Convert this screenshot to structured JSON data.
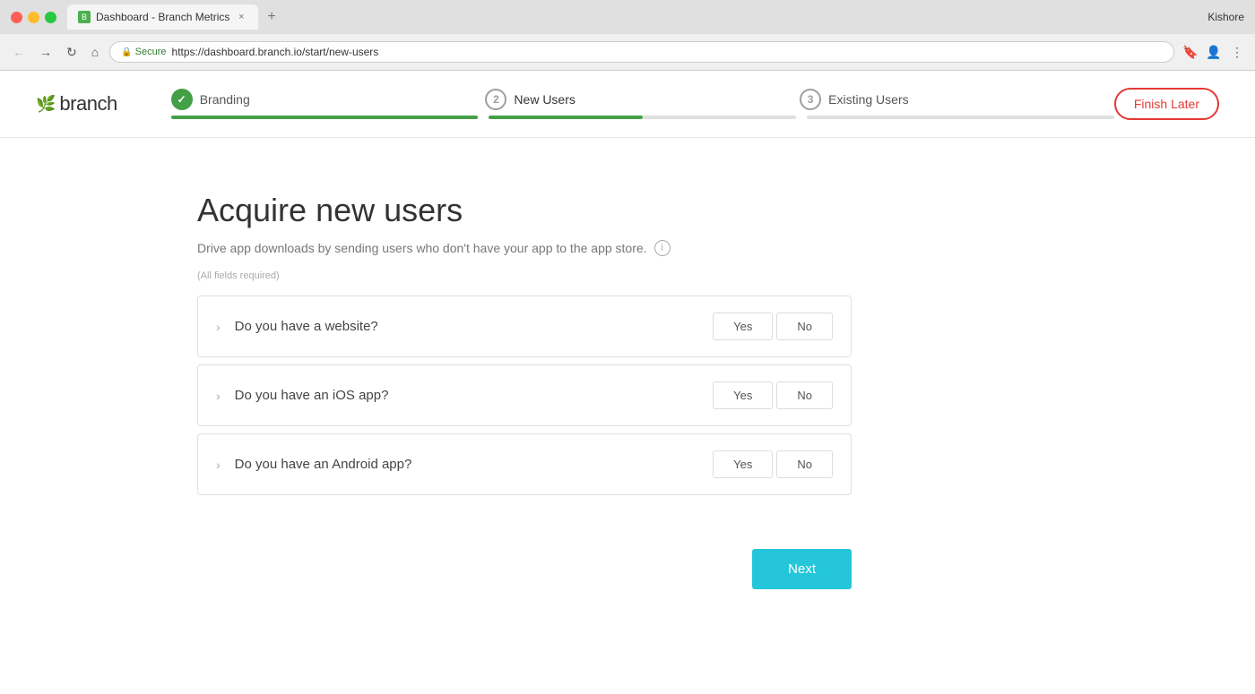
{
  "browser": {
    "tab_title": "Dashboard - Branch Metrics",
    "url": "https://dashboard.branch.io/start/new-users",
    "secure_label": "Secure",
    "user_name": "Kishore"
  },
  "nav": {
    "brand": "branch",
    "finish_later": "Finish Later",
    "steps": [
      {
        "number": "✓",
        "label": "Branding",
        "state": "complete"
      },
      {
        "number": "2",
        "label": "New Users",
        "state": "active"
      },
      {
        "number": "3",
        "label": "Existing Users",
        "state": "inactive"
      }
    ]
  },
  "page": {
    "title": "Acquire new users",
    "subtitle": "Drive app downloads by sending users who don't have your app to the app store.",
    "fields_required": "(All fields required)",
    "questions": [
      {
        "id": "website",
        "text": "Do you have a website?",
        "yes_label": "Yes",
        "no_label": "No"
      },
      {
        "id": "ios",
        "text": "Do you have an iOS app?",
        "yes_label": "Yes",
        "no_label": "No"
      },
      {
        "id": "android",
        "text": "Do you have an Android app?",
        "yes_label": "Yes",
        "no_label": "No"
      }
    ],
    "next_label": "Next"
  }
}
